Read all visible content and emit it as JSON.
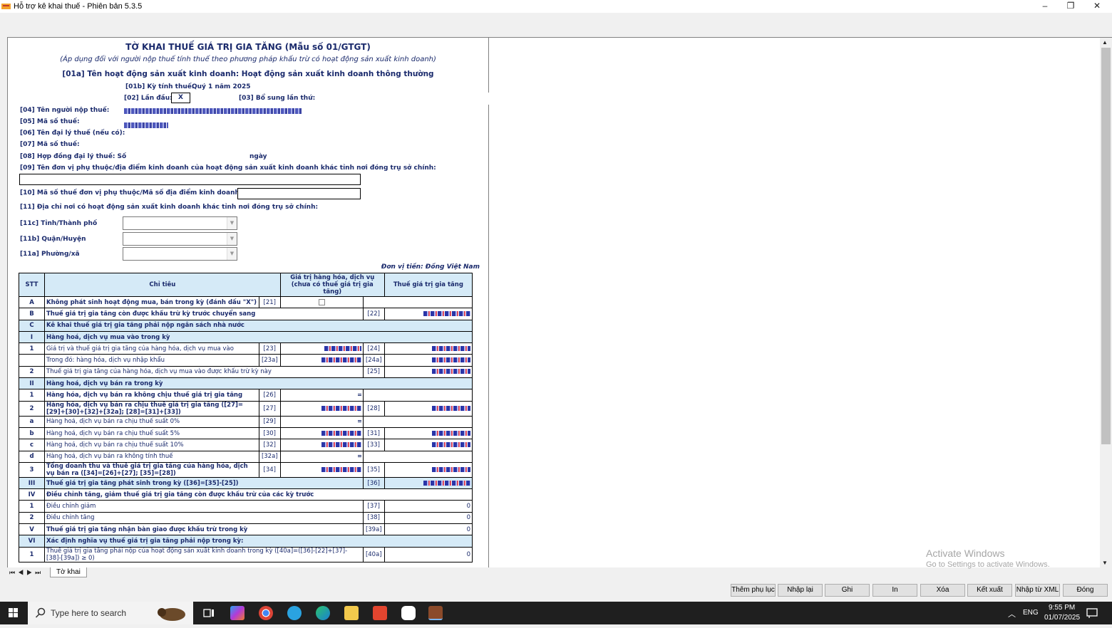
{
  "window": {
    "title": "Hỗ trợ kê khai thuế -  Phiên bản 5.3.5",
    "minimize": "–",
    "restore": "❐",
    "close": "✕"
  },
  "form": {
    "title": "TỜ KHAI THUẾ GIÁ TRỊ GIA TĂNG (Mẫu số 01/GTGT)",
    "subtitle": "(Áp dụng đối với người nộp thuế tính thuế theo phương pháp khấu trừ có hoạt động sản xuất kinh doanh)",
    "activity": "[01a] Tên hoạt động sản xuất kinh doanh: Hoạt động sản xuất kinh doanh thông thường",
    "period_label": "[01b] Kỳ tính thuế:",
    "period_value": "Quý 1 năm 2025",
    "first_label": "[02] Lần đầu:",
    "first_value": "X",
    "supplement_label": "[03] Bổ sung lần thứ:",
    "taxpayer_name_label": "[04] Tên người nộp thuế:",
    "tax_code_label": "[05] Mã số thuế:",
    "agent_name_label": "[06] Tên đại lý thuế (nếu có):",
    "agent_code_label": "[07] Mã số thuế:",
    "agent_contract_label": "[08] Hợp đồng đại lý thuế: Số",
    "agent_contract_day": "ngày",
    "branch_label": "[09] Tên đơn vị phụ thuộc/địa điểm kinh doanh của hoạt động sản xuất kinh doanh khác tỉnh nơi đóng trụ sở chính:",
    "branch_code_label": "[10] Mã số thuế đơn vị phụ thuộc/Mã số địa điểm kinh doanh:",
    "address_label": "[11] Địa chỉ nơi có hoạt động sản xuất kinh doanh khác tỉnh nơi đóng trụ sở chính:",
    "province_label": "[11c] Tỉnh/Thành phố",
    "district_label": "[11b] Quận/Huyện",
    "ward_label": "[11a] Phường/xã",
    "currency_unit": "Đơn vị tiền: Đồng Việt Nam"
  },
  "table": {
    "headers": [
      "STT",
      "Chỉ tiêu",
      "Giá trị hàng hóa, dịch vụ (chưa có thuế giá trị gia tăng)",
      "Thuế giá trị gia tăng"
    ],
    "rows": [
      {
        "stt": "A",
        "text": "Không phát sinh hoạt động mua, bán trong kỳ (đánh dấu \"X\")",
        "c1": "[21]",
        "v1": "",
        "c2": "",
        "v2": "",
        "bold": true,
        "blue": false
      },
      {
        "stt": "B",
        "text": "Thuế giá trị gia tăng còn được khấu trừ kỳ trước chuyển sang",
        "c1": "",
        "v1": "",
        "c2": "[22]",
        "v2": "",
        "bold": true,
        "blue": false
      },
      {
        "stt": "C",
        "text": "Kê khai thuế giá trị gia tăng phải nộp ngân sách nhà nước",
        "c1": "",
        "v1": "",
        "c2": "",
        "v2": "",
        "bold": true,
        "blue": true
      },
      {
        "stt": "I",
        "text": "Hàng hoá, dịch vụ mua vào trong kỳ",
        "c1": "",
        "v1": "",
        "c2": "",
        "v2": "",
        "bold": true,
        "blue": true
      },
      {
        "stt": "1",
        "text": "Giá trị và thuế giá trị gia tăng của hàng hóa, dịch vụ mua vào",
        "c1": "[23]",
        "v1": "",
        "c2": "[24]",
        "v2": "",
        "bold": false,
        "blue": false
      },
      {
        "stt": "",
        "text": "Trong đó: hàng hóa, dịch vụ nhập khẩu",
        "c1": "[23a]",
        "v1": "",
        "c2": "[24a]",
        "v2": "",
        "bold": false,
        "blue": false
      },
      {
        "stt": "2",
        "text": "Thuế giá trị gia tăng của hàng hóa, dịch vụ mua vào được khấu trừ kỳ này",
        "c1": "",
        "v1": "",
        "c2": "[25]",
        "v2": "",
        "bold": false,
        "blue": false
      },
      {
        "stt": "II",
        "text": "Hàng hoá, dịch vụ bán ra trong kỳ",
        "c1": "",
        "v1": "",
        "c2": "",
        "v2": "",
        "bold": true,
        "blue": true
      },
      {
        "stt": "1",
        "text": "Hàng hóa, dịch vụ bán ra không chịu thuế giá trị gia tăng",
        "c1": "[26]",
        "v1": "",
        "c2": "",
        "v2": "",
        "bold": true,
        "blue": false
      },
      {
        "stt": "2",
        "text": "Hàng hóa, dịch vụ bán ra chịu thuế giá trị gia tăng ([27]=[29]+[30]+[32]+[32a]; [28]=[31]+[33])",
        "c1": "[27]",
        "v1": "",
        "c2": "[28]",
        "v2": "",
        "bold": true,
        "blue": false
      },
      {
        "stt": "a",
        "text": "Hàng hoá, dịch vụ bán ra chịu thuế suất 0%",
        "c1": "[29]",
        "v1": "",
        "c2": "",
        "v2": "",
        "bold": false,
        "blue": false
      },
      {
        "stt": "b",
        "text": "Hàng hoá, dịch vụ bán ra chịu thuế suất 5%",
        "c1": "[30]",
        "v1": "",
        "c2": "[31]",
        "v2": "",
        "bold": false,
        "blue": false
      },
      {
        "stt": "c",
        "text": "Hàng hoá, dịch vụ bán ra chịu thuế suất 10%",
        "c1": "[32]",
        "v1": "",
        "c2": "[33]",
        "v2": "",
        "bold": false,
        "blue": false
      },
      {
        "stt": "d",
        "text": "Hàng hoá, dịch vụ bán ra không tính thuế",
        "c1": "[32a]",
        "v1": "",
        "c2": "",
        "v2": "",
        "bold": false,
        "blue": false
      },
      {
        "stt": "3",
        "text": "Tổng doanh thu và thuế giá trị gia tăng của hàng hóa, dịch vụ bán ra ([34]=[26]+[27]; [35]=[28])",
        "c1": "[34]",
        "v1": "",
        "c2": "[35]",
        "v2": "",
        "bold": true,
        "blue": false
      },
      {
        "stt": "III",
        "text": "Thuế giá trị gia tăng phát sinh trong kỳ ([36]=[35]-[25])",
        "c1": "",
        "v1": "",
        "c2": "[36]",
        "v2": "",
        "bold": true,
        "blue": true
      },
      {
        "stt": "IV",
        "text": "Điều chỉnh tăng, giảm thuế giá trị gia tăng còn được khấu trừ của các kỳ trước",
        "c1": "",
        "v1": "",
        "c2": "",
        "v2": "",
        "bold": true,
        "blue": false
      },
      {
        "stt": "1",
        "text": "Điều chỉnh giảm",
        "c1": "",
        "v1": "",
        "c2": "[37]",
        "v2": "0",
        "bold": false,
        "blue": false
      },
      {
        "stt": "2",
        "text": "Điều chỉnh tăng",
        "c1": "",
        "v1": "",
        "c2": "[38]",
        "v2": "0",
        "bold": false,
        "blue": false
      },
      {
        "stt": "V",
        "text": "Thuế giá trị gia tăng nhận bàn giao được khấu trừ trong kỳ",
        "c1": "",
        "v1": "",
        "c2": "[39a]",
        "v2": "0",
        "bold": true,
        "blue": false
      },
      {
        "stt": "VI",
        "text": "Xác định nghĩa vụ thuế giá trị gia tăng phải nộp trong kỳ:",
        "c1": "",
        "v1": "",
        "c2": "",
        "v2": "",
        "bold": true,
        "blue": true
      },
      {
        "stt": "1",
        "text": "Thuế giá trị gia tăng phải nộp của hoạt động sản xuất kinh doanh trong kỳ ([40a]=([36]-[22]+[37]-[38]-[39a]) ≥ 0)",
        "c1": "",
        "v1": "",
        "c2": "[40a]",
        "v2": "0",
        "bold": false,
        "blue": false
      }
    ]
  },
  "sheet_tab": "Tờ khai",
  "sheet_nav": "⏮◀▶⏭",
  "watermark": {
    "line1": "Activate Windows",
    "line2": "Go to Settings to activate Windows."
  },
  "buttons": {
    "add_appendix": "Thêm phụ lục",
    "reenter": "Nhập lại",
    "save": "Ghi",
    "print": "In",
    "delete": "Xóa",
    "export": "Kết xuất",
    "import_xml": "Nhập từ XML",
    "close": "Đóng"
  },
  "taskbar": {
    "search_placeholder": "Type here to search",
    "lang": "ENG",
    "time": "9:55 PM",
    "date": "01/07/2025"
  },
  "colors": {
    "header_blue": "#d5eaf7",
    "form_text": "#1a2a6c"
  }
}
